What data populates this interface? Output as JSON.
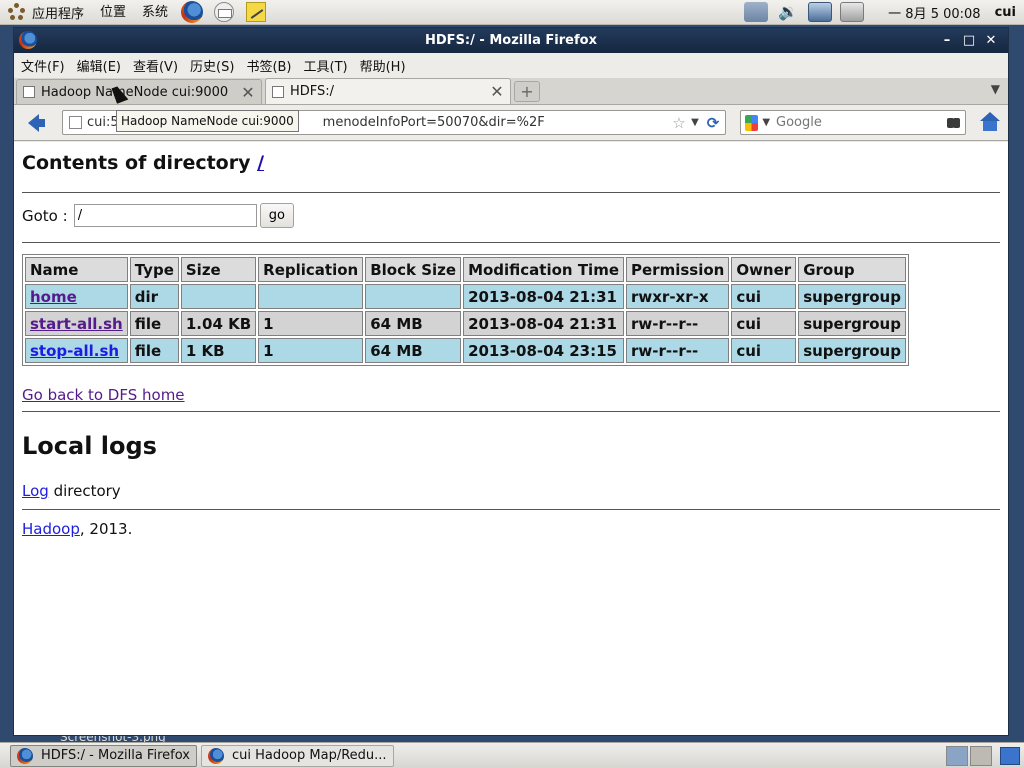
{
  "top_panel": {
    "menus": [
      "应用程序",
      "位置",
      "系统"
    ],
    "clock": "一 8月  5 00:08",
    "user": "cui",
    "launcher_icons": [
      "firefox-icon",
      "mail-icon",
      "notes-icon"
    ],
    "tray_icons": [
      "network-icon",
      "volume-icon",
      "display-icon",
      "printer-icon"
    ]
  },
  "window": {
    "title": "HDFS:/ - Mozilla Firefox",
    "controls": {
      "minimize": "–",
      "maximize": "□",
      "close": "✕"
    }
  },
  "menubar": [
    "文件(F)",
    "编辑(E)",
    "查看(V)",
    "历史(S)",
    "书签(B)",
    "工具(T)",
    "帮助(H)"
  ],
  "tabs": [
    {
      "label": "Hadoop NameNode cui:9000",
      "active": false
    },
    {
      "label": "HDFS:/",
      "active": true
    }
  ],
  "navbar": {
    "url_visible": "cui:5",
    "url_suffix": "menodeInfoPort=50070&dir=%2F",
    "search_placeholder": "Google"
  },
  "tooltip": "Hadoop NameNode cui:9000",
  "page": {
    "heading_prefix": "Contents of directory ",
    "heading_link": "/",
    "goto_label": "Goto :",
    "goto_value": "/",
    "go_button": "go",
    "table": {
      "headers": [
        "Name",
        "Type",
        "Size",
        "Replication",
        "Block Size",
        "Modification Time",
        "Permission",
        "Owner",
        "Group"
      ],
      "rows": [
        {
          "name": "home",
          "type": "dir",
          "size": "",
          "replication": "",
          "block_size": "",
          "mtime": "2013-08-04 21:31",
          "permission": "rwxr-xr-x",
          "owner": "cui",
          "group": "supergroup"
        },
        {
          "name": "start-all.sh",
          "type": "file",
          "size": "1.04 KB",
          "replication": "1",
          "block_size": "64 MB",
          "mtime": "2013-08-04 21:31",
          "permission": "rw-r--r--",
          "owner": "cui",
          "group": "supergroup"
        },
        {
          "name": "stop-all.sh",
          "type": "file",
          "size": "1 KB",
          "replication": "1",
          "block_size": "64 MB",
          "mtime": "2013-08-04 23:15",
          "permission": "rw-r--r--",
          "owner": "cui",
          "group": "supergroup"
        }
      ]
    },
    "back_link": "Go back to DFS home",
    "local_logs_heading": "Local logs",
    "log_link": "Log",
    "log_suffix": " directory",
    "hadoop_link": "Hadoop",
    "footer_suffix": ", 2013."
  },
  "taskbar": {
    "ghost_text": "Screenshot-3.png",
    "tasks": [
      {
        "label": "HDFS:/ - Mozilla Firefox",
        "active": true
      },
      {
        "label": "cui Hadoop Map/Redu...",
        "active": false
      }
    ]
  }
}
